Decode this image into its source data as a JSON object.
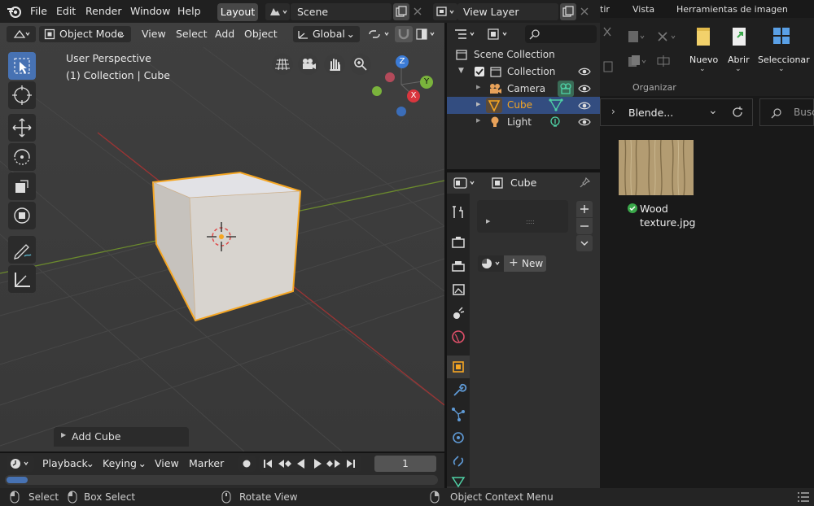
{
  "menu": [
    "File",
    "Edit",
    "Render",
    "Window",
    "Help"
  ],
  "workspace_tab": "Layout",
  "scene": "Scene",
  "view_layer": "View Layer",
  "viewport_header": {
    "mode": "Object Mode",
    "menus": [
      "View",
      "Select",
      "Add",
      "Object"
    ],
    "orientation": "Global"
  },
  "viewport": {
    "perspective": "User Perspective",
    "collection_info": "(1) Collection | Cube",
    "gizmo_axes": [
      "Z",
      "Y",
      "X"
    ],
    "last_operator": "Add Cube"
  },
  "outliner": {
    "root": "Scene Collection",
    "collection": "Collection",
    "items": [
      "Camera",
      "Cube",
      "Light"
    ]
  },
  "properties": {
    "object_name": "Cube",
    "new_button": "New",
    "list_grip": "::::"
  },
  "timeline": {
    "menus": [
      "Playback",
      "Keying",
      "View",
      "Marker"
    ],
    "frame": "1"
  },
  "statusbar": {
    "select": "Select",
    "box_select": "Box Select",
    "rotate_view": "Rotate View",
    "context_menu": "Object Context Menu"
  },
  "explorer": {
    "ribbon_tabs": [
      "tir",
      "Vista",
      "Herramientas de imagen"
    ],
    "ribbon_buttons": [
      "Nuevo",
      "Abrir",
      "Seleccionar"
    ],
    "ribbon_group": "Organizar",
    "breadcrumb": "Blende...",
    "search_placeholder": "Busc",
    "file_name_line1": "Wood",
    "file_name_line2": "texture.jpg"
  },
  "colors": {
    "accent_blue": "#4772b3",
    "selected_orange": "#f5a623",
    "axis_red": "#d9363e",
    "axis_green": "#7ab33c",
    "axis_blue": "#3b7bd6"
  }
}
